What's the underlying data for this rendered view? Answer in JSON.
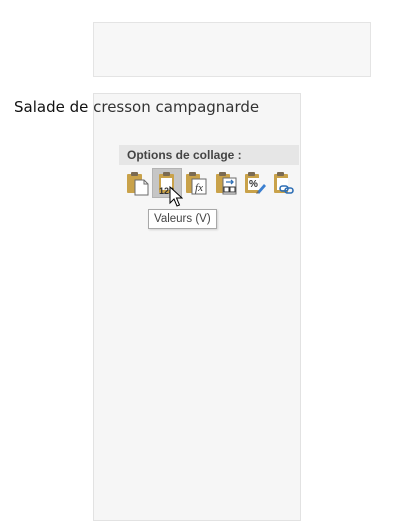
{
  "document": {
    "line_before": "Salade de",
    "line_after": " cresson campagnarde"
  },
  "paste_menu": {
    "header": "Options de collage :",
    "buttons": [
      {
        "name": "paste-keep-source-button",
        "icon": "clipboard-document-icon"
      },
      {
        "name": "paste-values-button",
        "icon": "clipboard-123-icon",
        "selected": true
      },
      {
        "name": "paste-formulas-button",
        "icon": "clipboard-fx-icon"
      },
      {
        "name": "paste-transpose-button",
        "icon": "clipboard-transpose-icon"
      },
      {
        "name": "paste-formatting-button",
        "icon": "clipboard-percent-brush-icon"
      },
      {
        "name": "paste-link-button",
        "icon": "clipboard-link-icon"
      }
    ],
    "icon_labels": {
      "values": "123",
      "formulas": "fx",
      "percent": "%"
    }
  },
  "tooltip": {
    "text": "Valeurs (V)"
  },
  "colors": {
    "clipboard_body": "#c9a24a",
    "clipboard_clip": "#7a6a52",
    "paper": "#ffffff",
    "link_blue": "#2e6fb5",
    "brush_blue": "#3b7fd0"
  }
}
